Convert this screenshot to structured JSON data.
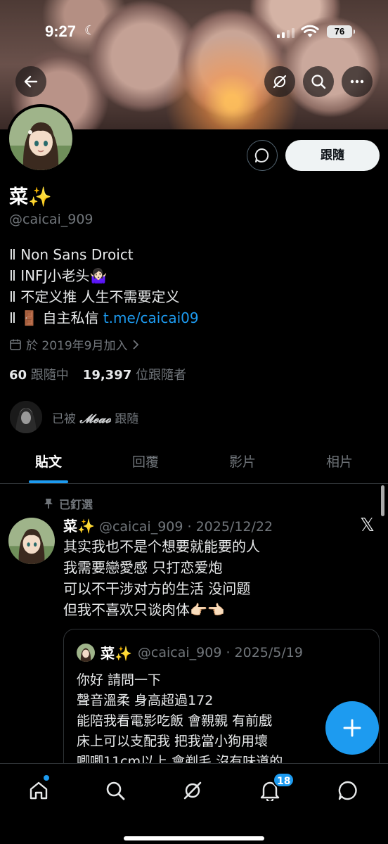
{
  "status_bar": {
    "time": "9:27",
    "battery": "76"
  },
  "profile": {
    "name": "菜✨",
    "handle": "@caicai_909",
    "bio": [
      "Ⅱ Non Sans Droict",
      "Ⅱ INFJ小老头🤷🏻‍♀️",
      "Ⅱ 不定义推 人生不需要定义",
      "Ⅱ 🚪 自主私信 "
    ],
    "bio_link": "t.me/caicai09",
    "joined": "於 2019年9月加入",
    "following_count": "60",
    "following_label": "跟隨中",
    "followers_count": "19,397",
    "followers_label": "位跟隨者",
    "followed_by_prefix": "已被",
    "followed_by_name": "𝓜𝓮𝓪𝓸",
    "followed_by_suffix": "跟隨",
    "follow_label": "跟隨"
  },
  "tabs": [
    {
      "label": "貼文",
      "active": true
    },
    {
      "label": "回覆",
      "active": false
    },
    {
      "label": "影片",
      "active": false
    },
    {
      "label": "相片",
      "active": false
    }
  ],
  "pinned_label": "已釘選",
  "tweet": {
    "name": "菜✨",
    "meta": "@caicai_909 · 2025/12/22",
    "lines": [
      "其实我也不是个想要就能要的人",
      "我需要戀愛感 只打恋爱炮",
      "可以不干涉对方的生活 没问题",
      "但我不喜欢只谈肉体👉🏻👈🏻"
    ]
  },
  "quote": {
    "name": "菜✨",
    "meta": "@caicai_909 · 2025/5/19",
    "lines": [
      "你好 請問一下",
      "聲音溫柔 身高超過172",
      "能陪我看電影吃飯 會親親 有前戲",
      "床上可以支配我 把我當小狗用壞",
      "唧唧11cm以上 會剃毛 沒有味道的"
    ]
  },
  "notifications_badge": "18",
  "colors": {
    "accent": "#1d9bf0",
    "background": "#000000",
    "muted": "#71767b"
  },
  "icons": [
    "back-arrow-icon",
    "grok-icon",
    "search-icon",
    "more-icon",
    "message-icon",
    "calendar-icon",
    "chevron-right-icon",
    "pin-icon",
    "x-logo-icon",
    "plus-icon",
    "home-icon",
    "explore-icon",
    "bell-icon",
    "mail-icon"
  ]
}
